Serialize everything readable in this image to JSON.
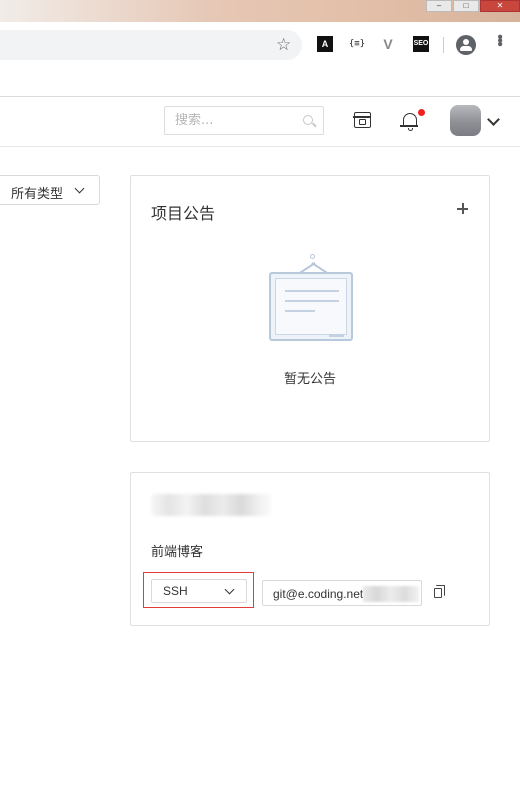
{
  "browser": {
    "window_buttons": [
      "–",
      "□",
      "✕"
    ],
    "extensions": [
      "A",
      "{≡}",
      "V",
      "SEO"
    ]
  },
  "header": {
    "search_placeholder": "搜索..."
  },
  "filter": {
    "type_label": "所有类型"
  },
  "announcement": {
    "title": "项目公告",
    "empty_text": "暂无公告"
  },
  "repo": {
    "description": "前端博客",
    "protocol": "SSH",
    "clone_url": "git@e.coding.net"
  }
}
